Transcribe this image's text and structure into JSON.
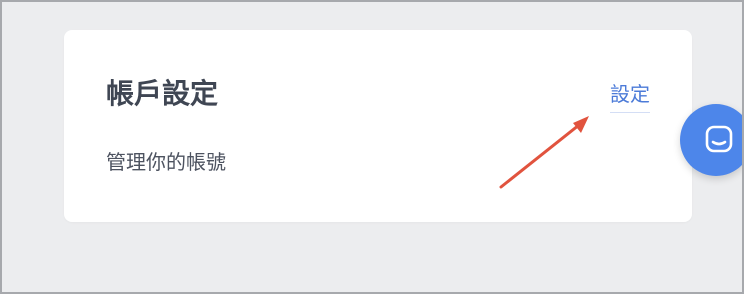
{
  "account_settings_card": {
    "title": "帳戶設定",
    "description": "管理你的帳號",
    "settings_link_label": "設定"
  },
  "annotation": {
    "arrow_color": "#E1533E"
  },
  "chat_launcher": {
    "icon": "chat-bubble-icon",
    "color": "#4D86EA"
  },
  "colors": {
    "link": "#4C7BD8",
    "card_background": "#FFFFFF",
    "page_background": "#ECEDEF"
  }
}
